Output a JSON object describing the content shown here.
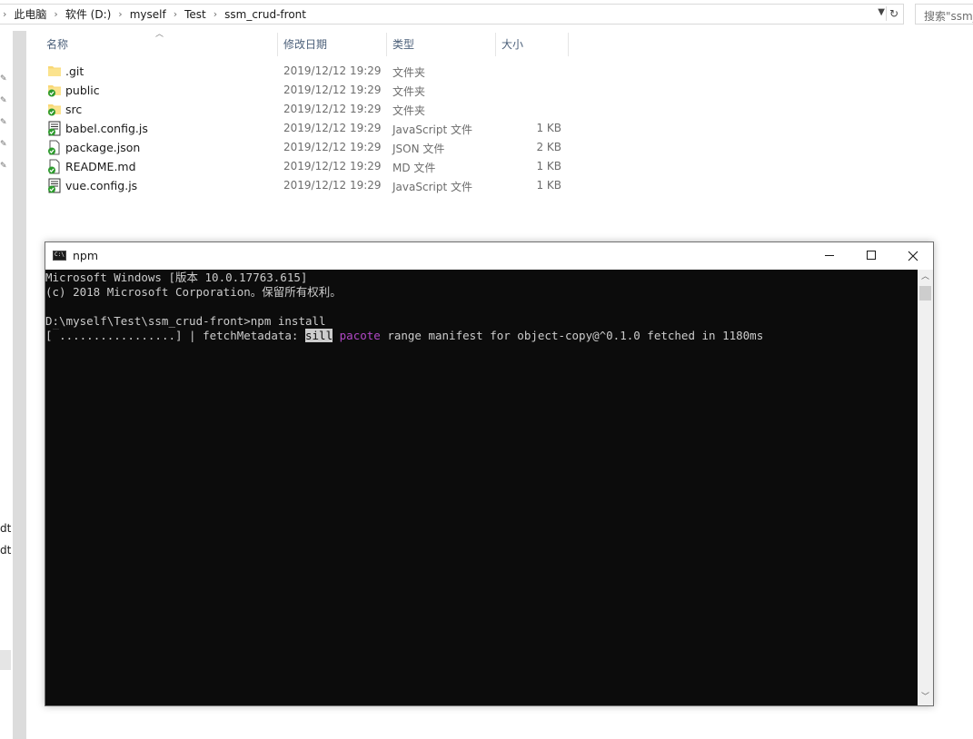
{
  "address_bar": {
    "crumbs": [
      "此电脑",
      "软件 (D:)",
      "myself",
      "Test",
      "ssm_crud-front"
    ]
  },
  "search": {
    "placeholder": "搜索\"ssm_"
  },
  "nav_pane": {
    "partial_items": [
      "dt",
      "dt"
    ]
  },
  "file_list": {
    "columns": {
      "name": "名称",
      "date": "修改日期",
      "type": "类型",
      "size": "大小"
    },
    "rows": [
      {
        "name": ".git",
        "date": "2019/12/12 19:29",
        "type": "文件夹",
        "size": "",
        "icon": "folder-icon"
      },
      {
        "name": "public",
        "date": "2019/12/12 19:29",
        "type": "文件夹",
        "size": "",
        "icon": "folder-synced-icon"
      },
      {
        "name": "src",
        "date": "2019/12/12 19:29",
        "type": "文件夹",
        "size": "",
        "icon": "folder-synced-icon"
      },
      {
        "name": "babel.config.js",
        "date": "2019/12/12 19:29",
        "type": "JavaScript 文件",
        "size": "1 KB",
        "icon": "script-file-icon"
      },
      {
        "name": "package.json",
        "date": "2019/12/12 19:29",
        "type": "JSON 文件",
        "size": "2 KB",
        "icon": "file-synced-icon"
      },
      {
        "name": "README.md",
        "date": "2019/12/12 19:29",
        "type": "MD 文件",
        "size": "1 KB",
        "icon": "file-synced-icon"
      },
      {
        "name": "vue.config.js",
        "date": "2019/12/12 19:29",
        "type": "JavaScript 文件",
        "size": "1 KB",
        "icon": "script-file-icon"
      }
    ]
  },
  "cmd_window": {
    "title": "npm",
    "lines": {
      "l1": "Microsoft Windows [版本 10.0.17763.615]",
      "l2": "(c) 2018 Microsoft Corporation。保留所有权利。",
      "l3": "D:\\myself\\Test\\ssm_crud-front>npm install",
      "progress_open": "[",
      "progress_cursor": "█",
      "progress_dots": ".................] | fetchMetadata: ",
      "level": "sill",
      "tag": "pacote",
      "message": " range manifest for object-copy@^0.1.0 fetched in 1180ms"
    }
  },
  "colors": {
    "console_bg": "#0c0c0c",
    "console_fg": "#cccccc",
    "npm_tag": "#b148c6",
    "header_text": "#4c607a",
    "sync_green": "#2e9b2e"
  }
}
